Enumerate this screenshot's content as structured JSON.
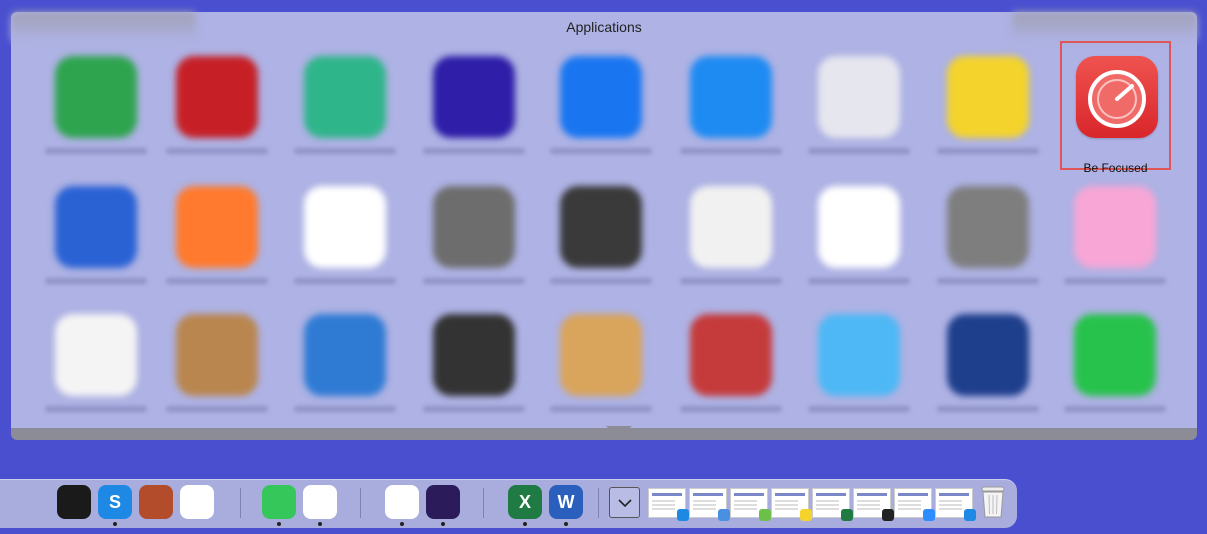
{
  "stack": {
    "title": "Applications",
    "highlighted_app": {
      "label": "Be Focused"
    },
    "blurred_apps": [
      {
        "name": "app-1",
        "color": "#2ea44f"
      },
      {
        "name": "app-2",
        "color": "#c62026"
      },
      {
        "name": "app-3",
        "color": "#2fb58a"
      },
      {
        "name": "app-4",
        "color": "#2e1ea8"
      },
      {
        "name": "app-5",
        "color": "#1976f0"
      },
      {
        "name": "app-6",
        "color": "#1e8bf2"
      },
      {
        "name": "app-7",
        "color": "#e6e6ee"
      },
      {
        "name": "app-8",
        "color": "#f3d32c"
      },
      {
        "name": "app-10",
        "color": "#2a62d4"
      },
      {
        "name": "app-11",
        "color": "#ff7a2e"
      },
      {
        "name": "app-12",
        "color": "#ffffff"
      },
      {
        "name": "app-13",
        "color": "#6d6d6d"
      },
      {
        "name": "app-14",
        "color": "#3a3a3a"
      },
      {
        "name": "app-15",
        "color": "#f1f1f1"
      },
      {
        "name": "app-16",
        "color": "#ffffff"
      },
      {
        "name": "app-17",
        "color": "#7e7e7e"
      },
      {
        "name": "app-18",
        "color": "#f7a6d6"
      },
      {
        "name": "app-19",
        "color": "#f4f4f4"
      },
      {
        "name": "app-20",
        "color": "#b9864f"
      },
      {
        "name": "app-21",
        "color": "#2f7bd4"
      },
      {
        "name": "app-22",
        "color": "#333333"
      },
      {
        "name": "app-23",
        "color": "#d9a45b"
      },
      {
        "name": "app-24",
        "color": "#c53b3b"
      },
      {
        "name": "app-25",
        "color": "#4db8f5"
      },
      {
        "name": "app-26",
        "color": "#1e3f8c"
      },
      {
        "name": "app-27",
        "color": "#27c24c"
      }
    ]
  },
  "dock": {
    "apps": [
      {
        "name": "screens-app",
        "letter": "",
        "color": "#1a1a1a",
        "running": false
      },
      {
        "name": "snagit-app",
        "letter": "S",
        "color": "#1e88e5",
        "running": true
      },
      {
        "name": "photo-booth-app",
        "letter": "",
        "color": "#b24c2a",
        "running": false
      },
      {
        "name": "photos-app",
        "letter": "",
        "color": "#ffffff",
        "running": false
      },
      {
        "name": "messages-app",
        "letter": "",
        "color": "#35c759",
        "running": true
      },
      {
        "name": "slack-app",
        "letter": "",
        "color": "#ffffff",
        "running": true
      },
      {
        "name": "safari-app",
        "letter": "",
        "color": "#ffffff",
        "running": true
      },
      {
        "name": "firefox-app",
        "letter": "",
        "color": "#2b1b5a",
        "running": true
      },
      {
        "name": "excel-app",
        "letter": "X",
        "color": "#1f7a43",
        "running": true
      },
      {
        "name": "word-app",
        "letter": "W",
        "color": "#2b5fbd",
        "running": true
      }
    ],
    "colors": {
      "excel": "#1f7a43",
      "word": "#2b5fbd",
      "highlight_border": "#e05555"
    }
  }
}
